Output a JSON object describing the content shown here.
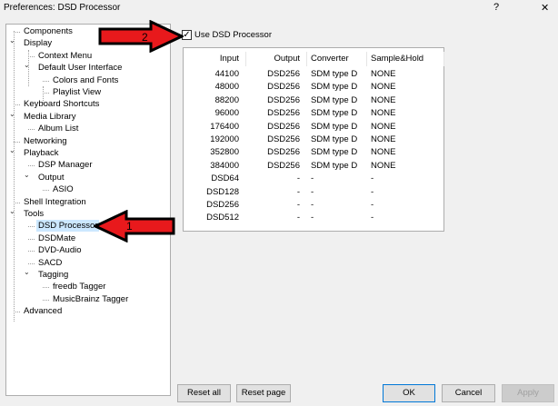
{
  "window": {
    "title": "Preferences: DSD Processor",
    "help": "?",
    "close": "✕"
  },
  "tree": [
    {
      "label": "Components",
      "level": 0,
      "expanded": null
    },
    {
      "label": "Display",
      "level": 0,
      "expanded": true
    },
    {
      "label": "Context Menu",
      "level": 1,
      "expanded": null
    },
    {
      "label": "Default User Interface",
      "level": 1,
      "expanded": true
    },
    {
      "label": "Colors and Fonts",
      "level": 2,
      "expanded": null
    },
    {
      "label": "Playlist View",
      "level": 2,
      "expanded": null
    },
    {
      "label": "Keyboard Shortcuts",
      "level": 0,
      "expanded": null
    },
    {
      "label": "Media Library",
      "level": 0,
      "expanded": true
    },
    {
      "label": "Album List",
      "level": 1,
      "expanded": null
    },
    {
      "label": "Networking",
      "level": 0,
      "expanded": null
    },
    {
      "label": "Playback",
      "level": 0,
      "expanded": true
    },
    {
      "label": "DSP Manager",
      "level": 1,
      "expanded": null
    },
    {
      "label": "Output",
      "level": 1,
      "expanded": true
    },
    {
      "label": "ASIO",
      "level": 2,
      "expanded": null
    },
    {
      "label": "Shell Integration",
      "level": 0,
      "expanded": null
    },
    {
      "label": "Tools",
      "level": 0,
      "expanded": true
    },
    {
      "label": "DSD Processor",
      "level": 1,
      "expanded": null,
      "selected": true
    },
    {
      "label": "DSDMate",
      "level": 1,
      "expanded": null
    },
    {
      "label": "DVD-Audio",
      "level": 1,
      "expanded": null
    },
    {
      "label": "SACD",
      "level": 1,
      "expanded": null
    },
    {
      "label": "Tagging",
      "level": 1,
      "expanded": true
    },
    {
      "label": "freedb Tagger",
      "level": 2,
      "expanded": null
    },
    {
      "label": "MusicBrainz Tagger",
      "level": 2,
      "expanded": null
    },
    {
      "label": "Advanced",
      "level": 0,
      "expanded": null
    }
  ],
  "use_dsd": {
    "label": "Use DSD Processor",
    "checked": true
  },
  "table": {
    "columns": [
      "Input",
      "Output",
      "Converter",
      "Sample&Hold"
    ],
    "rows": [
      [
        "44100",
        "DSD256",
        "SDM type D",
        "NONE"
      ],
      [
        "48000",
        "DSD256",
        "SDM type D",
        "NONE"
      ],
      [
        "88200",
        "DSD256",
        "SDM type D",
        "NONE"
      ],
      [
        "96000",
        "DSD256",
        "SDM type D",
        "NONE"
      ],
      [
        "176400",
        "DSD256",
        "SDM type D",
        "NONE"
      ],
      [
        "192000",
        "DSD256",
        "SDM type D",
        "NONE"
      ],
      [
        "352800",
        "DSD256",
        "SDM type D",
        "NONE"
      ],
      [
        "384000",
        "DSD256",
        "SDM type D",
        "NONE"
      ],
      [
        "DSD64",
        "-",
        "-",
        "-"
      ],
      [
        "DSD128",
        "-",
        "-",
        "-"
      ],
      [
        "DSD256",
        "-",
        "-",
        "-"
      ],
      [
        "DSD512",
        "-",
        "-",
        "-"
      ]
    ]
  },
  "buttons": {
    "reset_all": "Reset all",
    "reset_page": "Reset page",
    "ok": "OK",
    "cancel": "Cancel",
    "apply": "Apply"
  },
  "annotations": [
    {
      "label": "1",
      "color": "#e8191c"
    },
    {
      "label": "2",
      "color": "#e8191c"
    }
  ]
}
